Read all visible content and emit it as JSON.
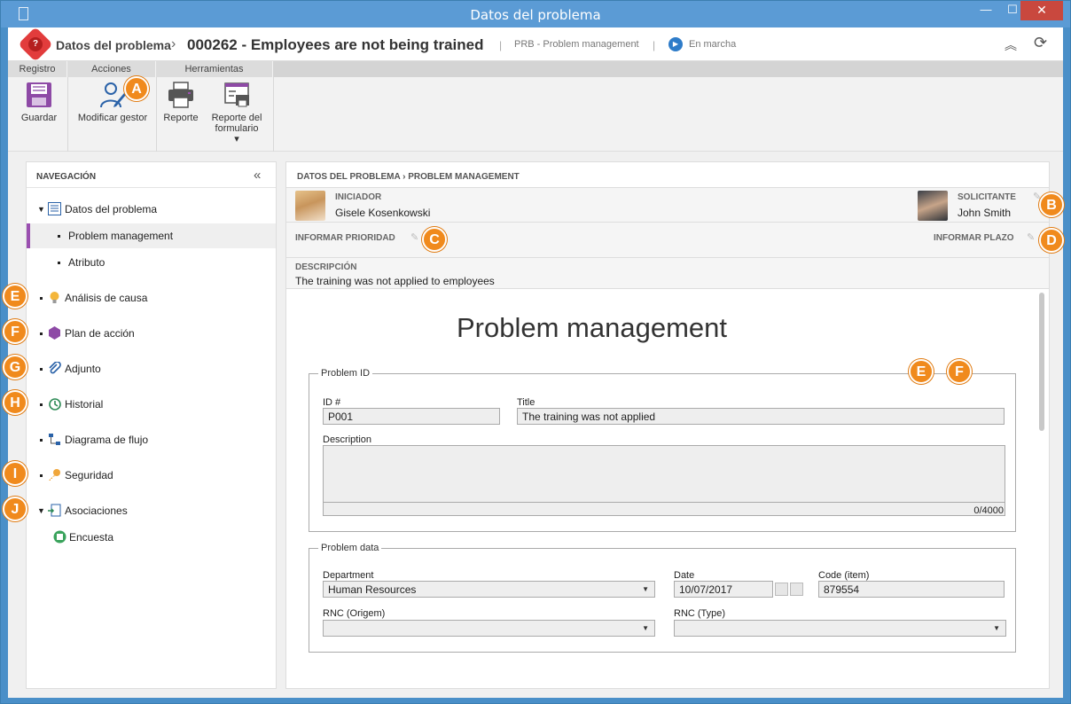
{
  "window": {
    "title": "Datos del problema",
    "minimize": "—",
    "maximize": "☐",
    "close": "✕"
  },
  "header": {
    "logo_glyph": "?",
    "breadcrumb_root": "Datos del problema",
    "breadcrumb_sep": "›",
    "record_title": "000262 - Employees are not being trained",
    "sep": "|",
    "module": "PRB - Problem management",
    "status_glyph": "▶",
    "status": "En marcha",
    "collapse_glyph": "︽",
    "refresh_glyph": "⟳"
  },
  "ribbon": {
    "groups": [
      "Registro",
      "Acciones",
      "Herramientas"
    ],
    "buttons": {
      "save": "Guardar",
      "modify_manager": "Modificar gestor",
      "report": "Reporte",
      "form_report_1": "Reporte del",
      "form_report_2": "formulario",
      "dropdown_glyph": "▾"
    }
  },
  "badges": [
    "A",
    "B",
    "C",
    "D",
    "E",
    "F",
    "G",
    "H",
    "I",
    "J"
  ],
  "nav": {
    "title": "NAVEGACIÓN",
    "collapse_glyph": "«",
    "items": [
      "Datos del problema",
      "Problem management",
      "Atributo",
      "Análisis de causa",
      "Plan de acción",
      "Adjunto",
      "Historial",
      "Diagrama de flujo",
      "Seguridad",
      "Asociaciones",
      "Encuesta"
    ]
  },
  "main": {
    "breadcrumb_1": "DATOS DEL PROBLEMA",
    "breadcrumb_sep": "›",
    "breadcrumb_2": "PROBLEM MANAGEMENT",
    "initiator_label": "INICIADOR",
    "initiator_name": "Gisele Kosenkowski",
    "requester_label": "SOLICITANTE",
    "requester_name": "John Smith",
    "priority_label": "INFORMAR PRIORIDAD",
    "deadline_label": "INFORMAR PLAZO",
    "pencil_glyph": "✎",
    "description_label": "DESCRIPCIÓN",
    "description": "The training was not applied to employees"
  },
  "form": {
    "title": "Problem management",
    "section1": "Problem ID",
    "id_label": "ID #",
    "id_value": "P001",
    "title_label": "Title",
    "title_value": "The training was not applied",
    "description_label": "Description",
    "description_counter": "0/4000",
    "section2": "Problem data",
    "department_label": "Department",
    "department_value": "Human Resources",
    "date_label": "Date",
    "date_value": "10/07/2017",
    "code_label": "Code (item)",
    "code_value": "879554",
    "rnc_origem_label": "RNC (Origem)",
    "rnc_type_label": "RNC (Type)"
  },
  "colors": {
    "badge": "#f08a1d",
    "accent_purple": "#9a4fb0",
    "status_blue": "#2e7cc9",
    "logo_red": "#e23c3c"
  }
}
